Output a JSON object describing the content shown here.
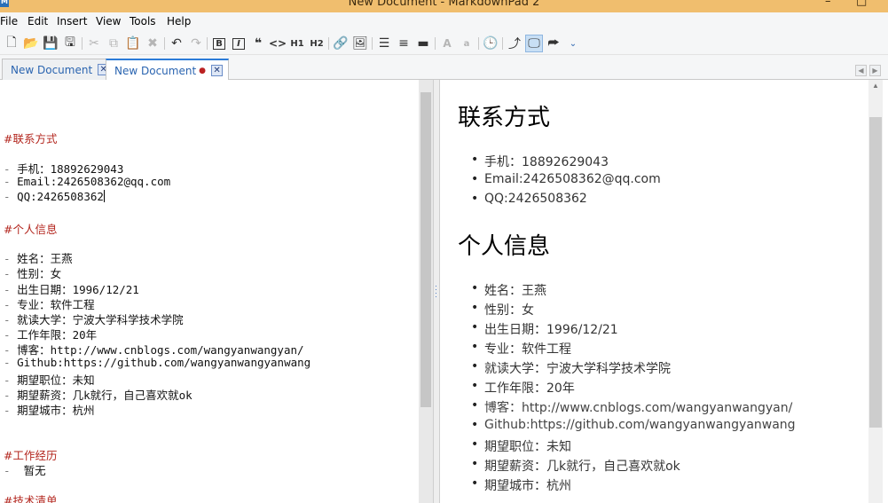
{
  "window": {
    "title": "New Document - MarkdownPad 2",
    "app_icon": "M"
  },
  "menu": [
    "File",
    "Edit",
    "Insert",
    "View",
    "Tools",
    "Help"
  ],
  "toolbar_icons": [
    "new-file-icon",
    "open-icon",
    "save-icon",
    "save-all-icon",
    "cut-icon",
    "copy-icon",
    "paste-icon",
    "delete-icon",
    "undo-icon",
    "redo-icon",
    "bold-icon",
    "italic-icon",
    "quote-icon",
    "code-icon",
    "h1-icon",
    "h2-icon",
    "link-icon",
    "image-icon",
    "unordered-list-icon",
    "ordered-list-icon",
    "horizontal-rule-icon",
    "uppercase-icon",
    "lowercase-icon",
    "timestamp-icon",
    "sync-scroll-icon",
    "live-preview-icon",
    "export-icon"
  ],
  "tabs": [
    {
      "label": "New Document",
      "active": false
    },
    {
      "label": "New Document",
      "active": true,
      "dirty_mark": "●"
    }
  ],
  "editor": {
    "lines": [
      {
        "text": "#联系方式",
        "heading": true
      },
      {
        "dash": "- ",
        "text": "手机：18892629043"
      },
      {
        "dash": "- ",
        "text": "Email:2426508362@qq.com"
      },
      {
        "dash": "- ",
        "text": "QQ:2426508362"
      },
      {
        "text": "#个人信息",
        "heading": true
      },
      {
        "dash": "- ",
        "text": "姓名：王燕"
      },
      {
        "dash": "- ",
        "text": "性别：女"
      },
      {
        "dash": "- ",
        "text": "出生日期：1996/12/21"
      },
      {
        "dash": "- ",
        "text": "专业：软件工程"
      },
      {
        "dash": "- ",
        "text": "就读大学：宁波大学科学技术学院"
      },
      {
        "dash": "- ",
        "text": "工作年限：20年"
      },
      {
        "dash": "- ",
        "text": "博客：http://www.cnblogs.com/wangyanwangyan/"
      },
      {
        "dash": "- ",
        "text": "Github:https://github.com/wangyanwangyanwang"
      },
      {
        "dash": "- ",
        "text": "期望职位：未知"
      },
      {
        "dash": "- ",
        "text": "期望薪资：几k就行，自己喜欢就ok"
      },
      {
        "dash": "- ",
        "text": "期望城市：杭州"
      },
      {
        "text": "#工作经历",
        "heading": true
      },
      {
        "dash": "- ",
        "text": " 暂无"
      },
      {
        "text": "#技术清单",
        "heading": true
      }
    ]
  },
  "preview": {
    "h1_contact": "联系方式",
    "contact_items": [
      "手机：18892629043",
      "Email:2426508362@qq.com",
      "QQ:2426508362"
    ],
    "h1_personal": "个人信息",
    "personal_items": [
      "姓名：王燕",
      "性别：女",
      "出生日期：1996/12/21",
      "专业：软件工程",
      "就读大学：宁波大学科学技术学院",
      "工作年限：20年",
      "博客：http://www.cnblogs.com/wangyanwangyan/",
      "Github:https://github.com/wangyanwangyanwang",
      "期望职位：未知",
      "期望薪资：几k就行，自己喜欢就ok",
      "期望城市：杭州"
    ]
  },
  "colors": {
    "titlebar": "#f0be6e",
    "heading_text": "#b3261e",
    "tab_text": "#2a64b0"
  }
}
